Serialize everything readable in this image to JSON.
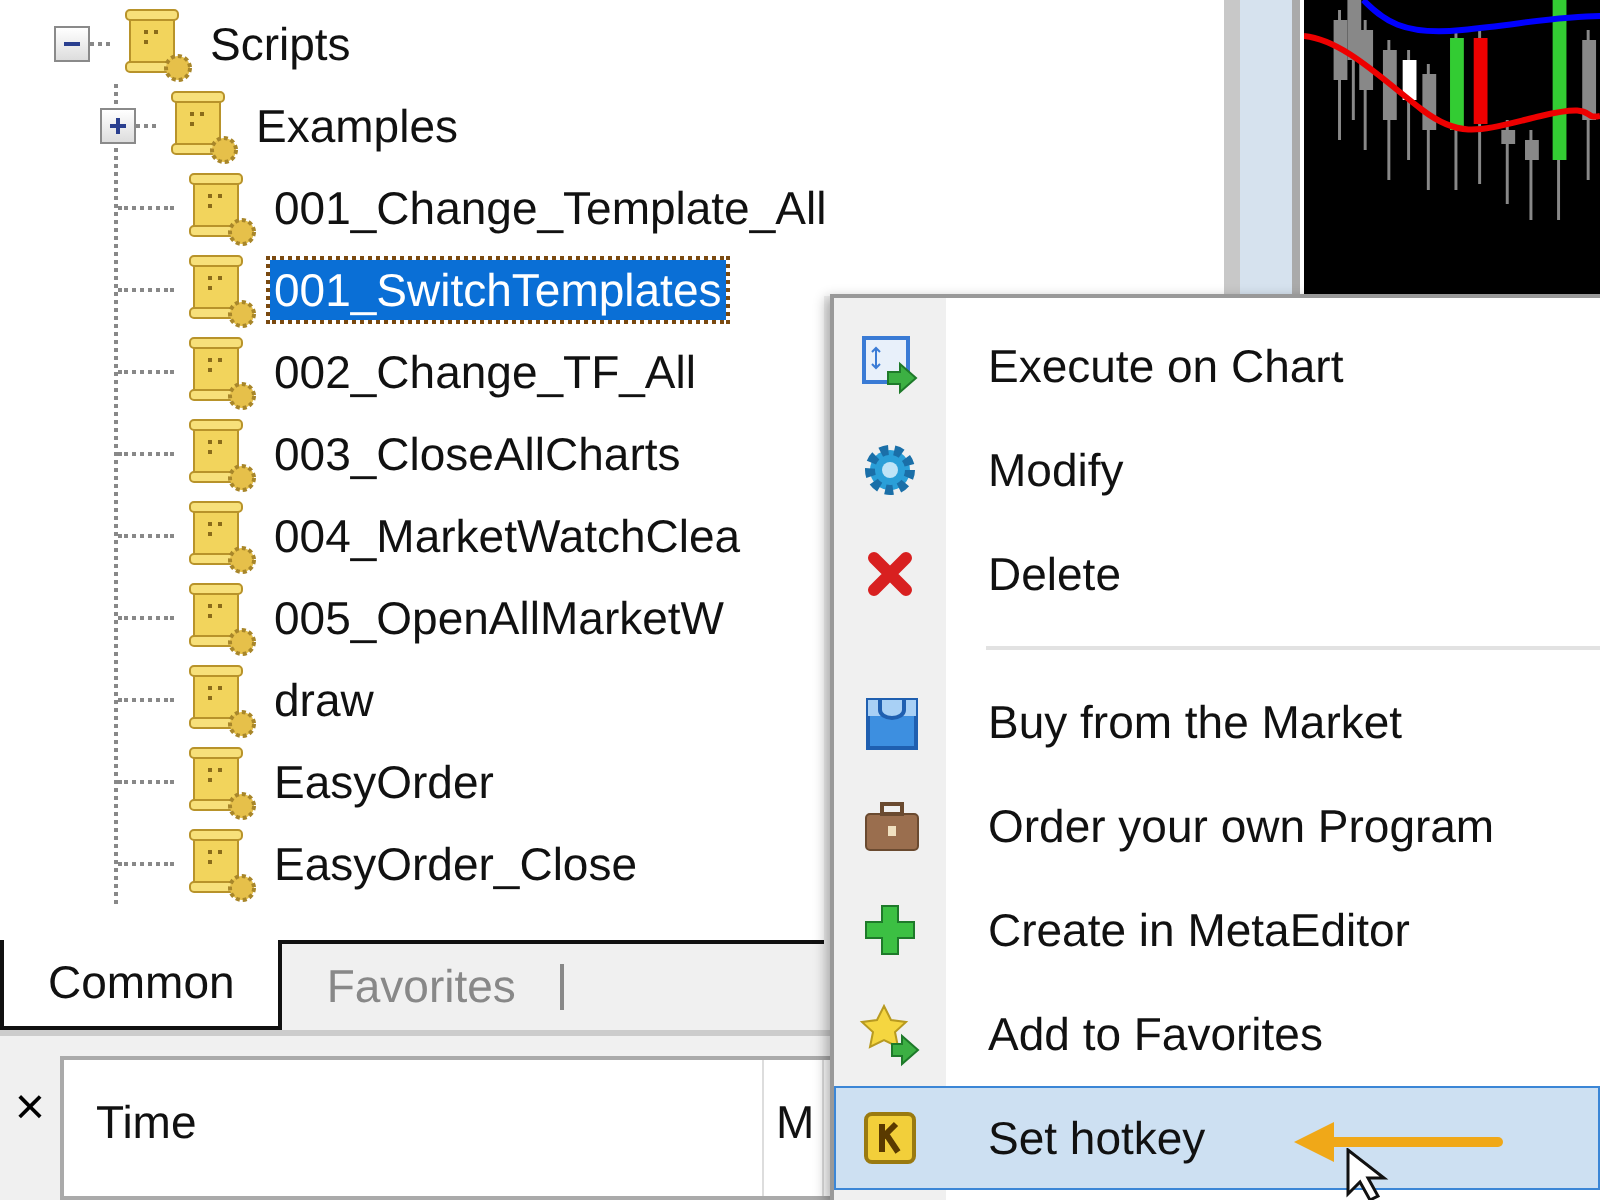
{
  "navigator": {
    "tree": [
      {
        "label": "Scripts",
        "expanded": true,
        "selected": false,
        "children": [
          {
            "label": "Examples",
            "expanded": false,
            "selected": false
          },
          {
            "label": "001_Change_Template_All",
            "selected": false
          },
          {
            "label": "001_SwitchTemplates",
            "selected": true
          },
          {
            "label": "002_Change_TF_All",
            "selected": false
          },
          {
            "label": "003_CloseAllCharts",
            "selected": false
          },
          {
            "label": "004_MarketWatchClea",
            "selected": false
          },
          {
            "label": "005_OpenAllMarketW",
            "selected": false
          },
          {
            "label": "draw",
            "selected": false
          },
          {
            "label": "EasyOrder",
            "selected": false
          },
          {
            "label": "EasyOrder_Close",
            "selected": false
          }
        ]
      }
    ],
    "tabs": [
      {
        "label": "Common",
        "selected": true
      },
      {
        "label": "Favorites",
        "selected": false
      }
    ]
  },
  "context_menu": [
    {
      "kind": "item",
      "label": "Execute on Chart",
      "selected": false
    },
    {
      "kind": "item",
      "label": "Modify",
      "selected": false
    },
    {
      "kind": "item",
      "label": "Delete",
      "selected": false
    },
    {
      "kind": "separator"
    },
    {
      "kind": "item",
      "label": "Buy from the Market",
      "selected": false
    },
    {
      "kind": "item",
      "label": "Order your own Program",
      "selected": false
    },
    {
      "kind": "item",
      "label": "Create in MetaEditor",
      "selected": false
    },
    {
      "kind": "item",
      "label": "Add to Favorites",
      "selected": false
    },
    {
      "kind": "item",
      "label": "Set hotkey",
      "selected": true
    }
  ],
  "toolbox": {
    "close": "×",
    "columns": [
      "Time",
      "M"
    ]
  }
}
